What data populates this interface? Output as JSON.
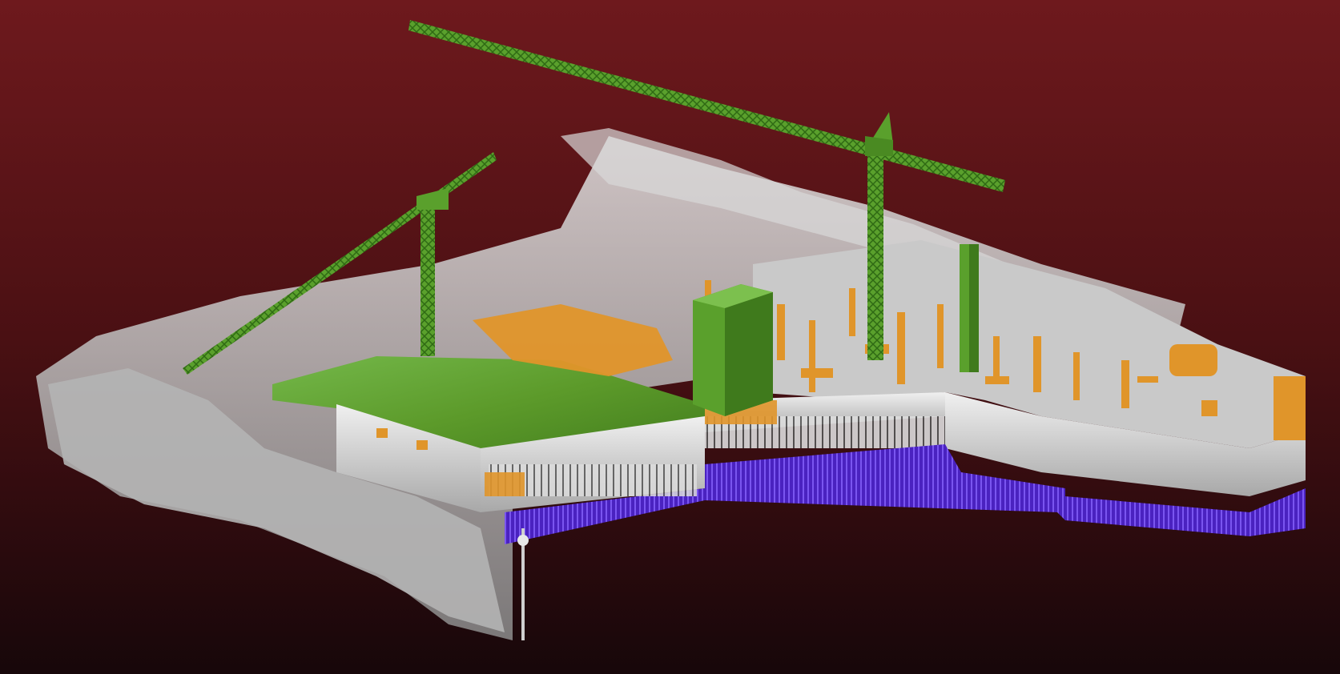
{
  "viewer": {
    "background_top": "#6e191d",
    "background_bottom": "#17070a"
  },
  "scene_classes": {
    "cranes_and_upper_structure": "#5aa02c",
    "scaffolding_and_equipment": "#e0952a",
    "concrete_and_ground": "#c8c8c8",
    "foundation_level": "#5a2fd0"
  }
}
